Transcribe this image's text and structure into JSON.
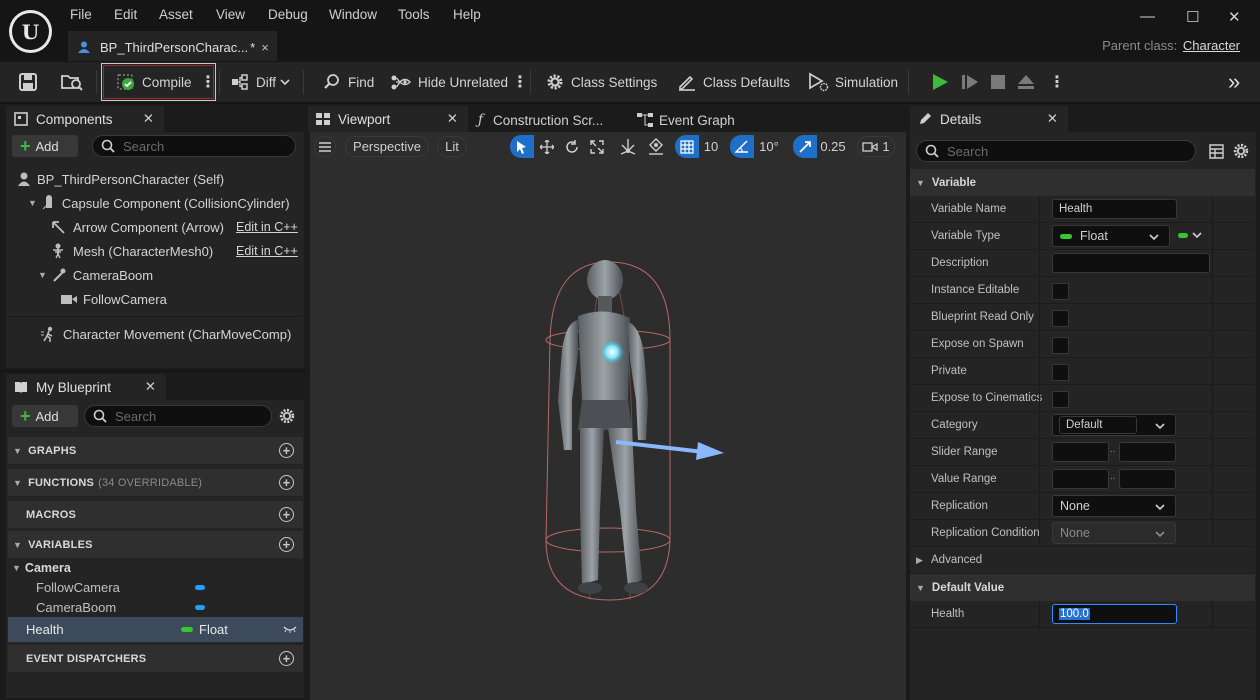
{
  "menu": [
    "File",
    "Edit",
    "Asset",
    "View",
    "Debug",
    "Window",
    "Tools",
    "Help"
  ],
  "logo_letter": "U",
  "document_tab": {
    "label": "BP_ThirdPersonCharac...",
    "modified": "*",
    "close": "×"
  },
  "window": {
    "minimize": "—",
    "maximize": "☐",
    "close": "✕"
  },
  "parent_class": {
    "prefix": "Parent class:",
    "value": "Character"
  },
  "toolbar": {
    "compile": "Compile",
    "diff": "Diff",
    "find": "Find",
    "hide_unrelated": "Hide Unrelated",
    "class_settings": "Class Settings",
    "class_defaults": "Class Defaults",
    "simulation": "Simulation",
    "more": "»"
  },
  "components": {
    "tab": "Components",
    "add": "Add",
    "search_placeholder": "Search",
    "items": [
      {
        "label": "BP_ThirdPersonCharacter (Self)"
      },
      {
        "label": "Capsule Component (CollisionCylinder)"
      },
      {
        "label": "Arrow Component (Arrow)",
        "link": "Edit in C++"
      },
      {
        "label": "Mesh (CharacterMesh0)",
        "link": "Edit in C++"
      },
      {
        "label": "CameraBoom"
      },
      {
        "label": "FollowCamera"
      },
      {
        "label": "Character Movement (CharMoveComp)"
      }
    ]
  },
  "my_blueprint": {
    "tab": "My Blueprint",
    "add": "Add",
    "search_placeholder": "Search",
    "sections": {
      "graphs": "GRAPHS",
      "functions": "FUNCTIONS",
      "functions_note": "(34 OVERRIDABLE)",
      "macros": "MACROS",
      "variables": "VARIABLES",
      "event_dispatchers": "EVENT DISPATCHERS"
    },
    "category": "Camera",
    "variables": [
      {
        "name": "FollowCamera"
      },
      {
        "name": "CameraBoom"
      }
    ],
    "selected_variable": {
      "name": "Health",
      "type": "Float"
    }
  },
  "editor_tabs": {
    "viewport": "Viewport",
    "construction": "Construction Scr...",
    "event_graph": "Event Graph"
  },
  "viewport": {
    "perspective": "Perspective",
    "lit": "Lit",
    "grid_snap": "10",
    "rotation_snap": "10°",
    "scale_snap": "0.25",
    "camera_speed": "1"
  },
  "details": {
    "tab": "Details",
    "search_placeholder": "Search",
    "variable_section": "Variable",
    "rows": {
      "variable_name": {
        "label": "Variable Name",
        "value": "Health"
      },
      "variable_type": {
        "label": "Variable Type",
        "value": "Float"
      },
      "description": {
        "label": "Description",
        "value": ""
      },
      "instance_editable": {
        "label": "Instance Editable"
      },
      "blueprint_read_only": {
        "label": "Blueprint Read Only"
      },
      "expose_on_spawn": {
        "label": "Expose on Spawn"
      },
      "private": {
        "label": "Private"
      },
      "expose_to_cinematics": {
        "label": "Expose to Cinematics"
      },
      "category": {
        "label": "Category",
        "value": "Default"
      },
      "slider_range": {
        "label": "Slider Range"
      },
      "value_range": {
        "label": "Value Range"
      },
      "replication": {
        "label": "Replication",
        "value": "None"
      },
      "replication_condition": {
        "label": "Replication Condition",
        "value": "None"
      }
    },
    "advanced_section": "Advanced",
    "default_value_section": "Default Value",
    "default_value": {
      "label": "Health",
      "value": "100.0"
    }
  },
  "colors": {
    "accent_blue": "#1ea0ff",
    "float_green": "#35c92f",
    "play_green": "#3dbb3d",
    "selected_row": "#3c4a5c"
  }
}
